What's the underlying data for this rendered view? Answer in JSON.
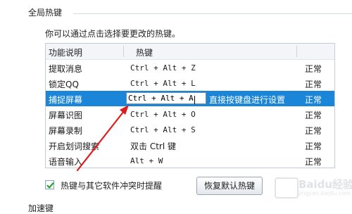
{
  "section": {
    "title": "全局热键",
    "description": "你可以通过点击选择要更改的热键。"
  },
  "table": {
    "headers": {
      "function": "功能说明",
      "hotkey": "热键"
    },
    "rows": [
      {
        "name": "提取消息",
        "key": "Ctrl + Alt + Z",
        "status": "正常"
      },
      {
        "name": "锁定QQ",
        "key": "Ctrl + Alt + L",
        "status": "正常"
      },
      {
        "name": "捕捉屏幕",
        "key": "Ctrl + Alt + A",
        "hint": "直接按键盘进行设置",
        "status": "正常",
        "selected": true
      },
      {
        "name": "屏幕识图",
        "key": "Ctrl + Alt + O",
        "status": "正常"
      },
      {
        "name": "屏幕录制",
        "key": "Ctrl + Alt + S",
        "status": "正常"
      },
      {
        "name": "开启划词搜索",
        "key": "双击 Ctrl 键",
        "status": "正常"
      },
      {
        "name": "语音输入",
        "key": "Alt + W",
        "status": "正常"
      }
    ]
  },
  "conflict_checkbox": {
    "label": "热键与其它软件冲突时提醒",
    "checked": true
  },
  "reset_button": {
    "label": "恢复默认热键"
  },
  "next_section": {
    "title": "加速键"
  },
  "watermark": {
    "text": "Baidu经验",
    "url": "jingyan.baidu.com"
  },
  "colors": {
    "selection": "#1b86d8",
    "arrow": "#e01b1b",
    "checkmark": "#2aa02a"
  }
}
